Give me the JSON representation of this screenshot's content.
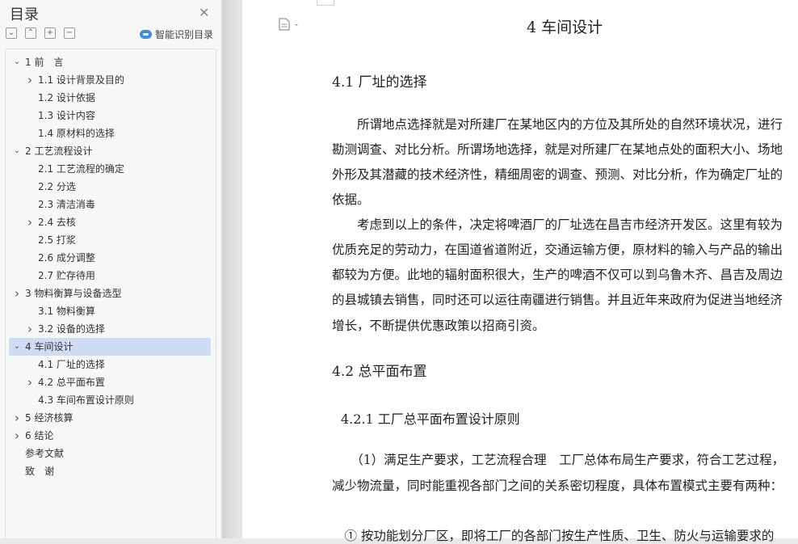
{
  "sidebar": {
    "title": "目录",
    "smart_toc_label": "智能识别目录",
    "tool_icons": [
      "collapse-all-icon",
      "expand-all-icon",
      "add-heading-icon",
      "remove-heading-icon"
    ],
    "items": [
      {
        "label": "1 前　言",
        "level": 1,
        "chevron": "down"
      },
      {
        "label": "1.1 设计背景及目的",
        "level": 2,
        "chevron": "right"
      },
      {
        "label": "1.2 设计依据",
        "level": 2,
        "chevron": ""
      },
      {
        "label": "1.3 设计内容",
        "level": 2,
        "chevron": ""
      },
      {
        "label": "1.4 原材料的选择",
        "level": 2,
        "chevron": ""
      },
      {
        "label": "2 工艺流程设计",
        "level": 1,
        "chevron": "down"
      },
      {
        "label": "2.1 工艺流程的确定",
        "level": 2,
        "chevron": ""
      },
      {
        "label": "2.2 分选",
        "level": 2,
        "chevron": ""
      },
      {
        "label": "2.3 清洁消毒",
        "level": 2,
        "chevron": ""
      },
      {
        "label": "2.4 去核",
        "level": 2,
        "chevron": "right"
      },
      {
        "label": "2.5 打浆",
        "level": 2,
        "chevron": ""
      },
      {
        "label": "2.6 成分调整",
        "level": 2,
        "chevron": ""
      },
      {
        "label": "2.7 贮存待用",
        "level": 2,
        "chevron": ""
      },
      {
        "label": "3  物料衡算与设备选型",
        "level": 1,
        "chevron": "right"
      },
      {
        "label": "3.1 物料衡算",
        "level": 2,
        "chevron": ""
      },
      {
        "label": "3.2 设备的选择",
        "level": 2,
        "chevron": "right"
      },
      {
        "label": "4 车间设计",
        "level": 1,
        "chevron": "down",
        "selected": true
      },
      {
        "label": "4.1  厂址的选择",
        "level": 2,
        "chevron": ""
      },
      {
        "label": "4.2  总平面布置",
        "level": 2,
        "chevron": "right"
      },
      {
        "label": "4.3  车间布置设计原则",
        "level": 2,
        "chevron": ""
      },
      {
        "label": "5 经济核算",
        "level": 1,
        "chevron": "right"
      },
      {
        "label": "6 结论",
        "level": 1,
        "chevron": "right"
      },
      {
        "label": "参考文献",
        "level": 1,
        "chevron": ""
      },
      {
        "label": "致　谢",
        "level": 1,
        "chevron": ""
      }
    ]
  },
  "document": {
    "chapter_title": "4 车间设计",
    "sec_4_1": "4.1  厂址的选择",
    "para1": [
      "　　所谓地点选择就是对所建厂在某地区内的方位及其所处的自然环境状况，进行",
      "勘测调查、对比分析。所谓场地选择，就是对所建厂在某地点处的面积大小、场地",
      "外形及其潜藏的技术经济性，精细周密的调查、预测、对比分析，作为确定厂址的",
      "依据。"
    ],
    "para2": [
      "　　考虑到以上的条件，决定将啤酒厂的厂址选在昌吉市经济开发区。这里有较为",
      "优质充足的劳动力，在国道省道附近，交通运输方便，原材料的输入与产品的输出",
      "都较为方便。此地的辐射面积很大，生产的啤酒不仅可以到乌鲁木齐、昌吉及周边",
      "的县城镇去销售，同时还可以运往南疆进行销售。并且近年来政府为促进当地经济",
      "增长，不断提供优惠政策以招商引资。"
    ],
    "sec_4_2": "4.2  总平面布置",
    "sec_4_2_1": "4.2.1 工厂总平面布置设计原则",
    "para3": [
      "　　（1）满足生产要求，工艺流程合理　工厂总体布局生产要求，符合工艺过程，",
      "减少物流量，同时能重视各部门之间的关系密切程度，具体布置模式主要有两种："
    ],
    "para4_partial": "　① 按功能划分厂区，即将工厂的各部门按生产性质、卫生、防火与运输要求的"
  },
  "colors": {
    "selected_row": "#cfdcf3",
    "smart_icon": "#3a8ee6",
    "sidebar_bg": "#f7f7f7"
  }
}
